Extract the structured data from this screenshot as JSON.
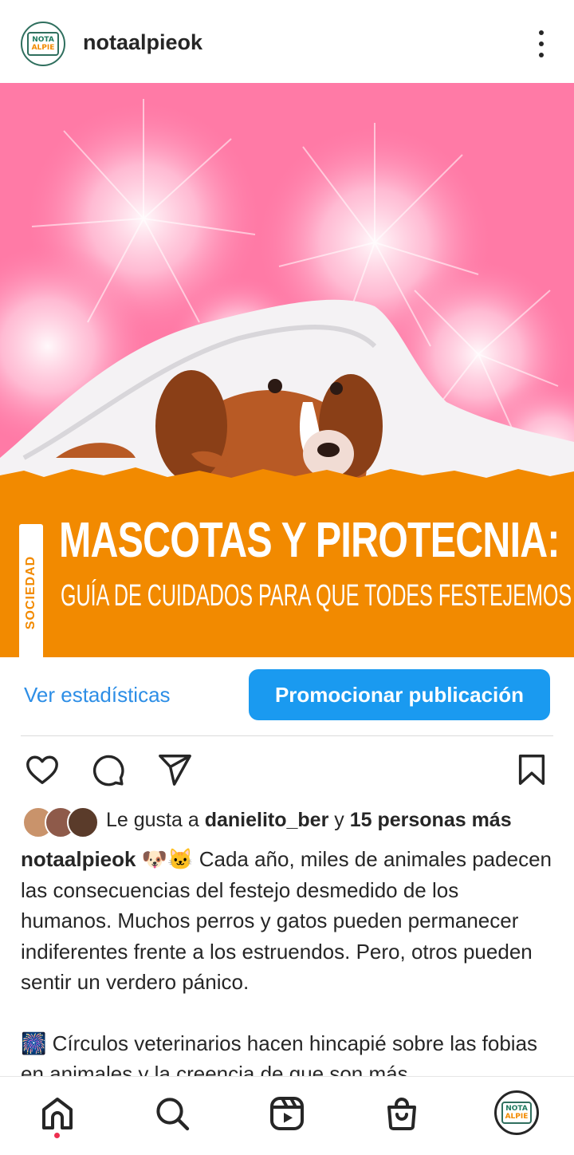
{
  "header": {
    "username": "notaalpieok",
    "logo_line1": "NOTA",
    "logo_line2": "ALPIE"
  },
  "post_image": {
    "section_tag": "SOCIEDAD",
    "headline": "MASCOTAS Y PIROTECNIA:",
    "subhead": "GUÍA DE CUIDADOS PARA QUE TODES FESTEJEMOS"
  },
  "insights": {
    "stats_label": "Ver estadísticas",
    "promote_label": "Promocionar publicación"
  },
  "likes": {
    "prefix": "Le gusta a ",
    "first_user": "danielito_ber",
    "joiner": " y ",
    "others": "15 personas más"
  },
  "caption": {
    "author": "notaalpieok",
    "emojis": "🐶🐱",
    "paragraph1": "Cada año, miles de animales padecen las consecuencias del festejo desmedido de los humanos. Muchos perros y gatos pueden permanecer indiferentes frente a los estruendos. Pero, otros pueden sentir un verdero pánico.",
    "emoji2": "🎆",
    "paragraph2": "Círculos veterinarios hacen hincapié sobre las fobias en animales y la creencia de que son más"
  },
  "colors": {
    "accent_blue": "#1a9af0",
    "link_blue": "#2d8ee6",
    "banner_orange": "#f28a00",
    "background_pink": "#ff7aa6"
  },
  "icons": [
    "more-vertical-icon",
    "heart-icon",
    "comment-icon",
    "share-icon",
    "bookmark-icon",
    "home-icon",
    "search-icon",
    "reels-icon",
    "shop-icon"
  ]
}
